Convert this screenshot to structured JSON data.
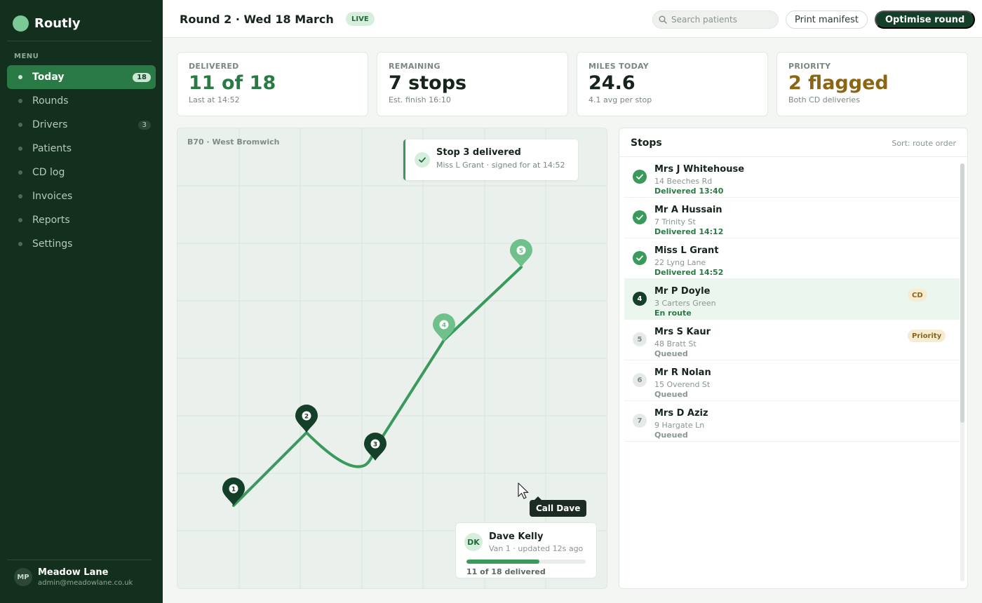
{
  "sidebar": {
    "brand": "Routly",
    "menu_label": "MENU",
    "items": [
      {
        "label": "Today",
        "count": "18"
      },
      {
        "label": "Rounds",
        "count": ""
      },
      {
        "label": "Drivers",
        "count": "3"
      },
      {
        "label": "Patients",
        "count": ""
      },
      {
        "label": "CD log",
        "count": ""
      },
      {
        "label": "Invoices",
        "count": ""
      },
      {
        "label": "Reports",
        "count": ""
      },
      {
        "label": "Settings",
        "count": ""
      }
    ],
    "profile": {
      "initials": "MP",
      "name": "Meadow Lane",
      "email": "admin@meadowlane.co.uk"
    }
  },
  "header": {
    "title": "Round 2 · Wed 18 March",
    "live_badge": "LIVE",
    "search_placeholder": "Search patients",
    "print_label": "Print manifest",
    "optimise_label": "Optimise round"
  },
  "stats": [
    {
      "key": "DELIVERED",
      "value": "11 of 18",
      "sub": "Last at 14:52"
    },
    {
      "key": "REMAINING",
      "value": "7 stops",
      "sub": "Est. finish 16:10"
    },
    {
      "key": "MILES TODAY",
      "value": "24.6",
      "sub": "4.1 avg per stop"
    },
    {
      "key": "PRIORITY",
      "value": "2 flagged",
      "sub": "Both CD deliveries"
    }
  ],
  "map": {
    "area_label": "B70 · West Bromwich",
    "pins": [
      "1",
      "2",
      "3",
      "4",
      "5"
    ],
    "toast": {
      "title": "Stop 3 delivered",
      "subtitle": "Miss L Grant · signed for at 14:52"
    },
    "tooltip": "Call Dave",
    "driver": {
      "initials": "DK",
      "name": "Dave Kelly",
      "meta": "Van 1 · updated 12s ago",
      "progress_fraction": 0.611,
      "progress_text": "11 of 18 delivered"
    }
  },
  "stops": {
    "title": "Stops",
    "sort_label": "Sort: route order",
    "items": [
      {
        "marker": "",
        "name": "Mrs J Whitehouse",
        "address": "14 Beeches Rd",
        "status": "Delivered 13:40",
        "tag": ""
      },
      {
        "marker": "",
        "name": "Mr A Hussain",
        "address": "7 Trinity St",
        "status": "Delivered 14:12",
        "tag": ""
      },
      {
        "marker": "",
        "name": "Miss L Grant",
        "address": "22 Lyng Lane",
        "status": "Delivered 14:52",
        "tag": ""
      },
      {
        "marker": "4",
        "name": "Mr P Doyle",
        "address": "3 Carters Green",
        "status": "En route",
        "tag": "CD"
      },
      {
        "marker": "5",
        "name": "Mrs S Kaur",
        "address": "48 Bratt St",
        "status": "Queued",
        "tag": "Priority"
      },
      {
        "marker": "6",
        "name": "Mr R Nolan",
        "address": "15 Overend St",
        "status": "Queued",
        "tag": ""
      },
      {
        "marker": "7",
        "name": "Mrs D Aziz",
        "address": "9 Hargate Ln",
        "status": "Queued",
        "tag": ""
      }
    ]
  },
  "colors": {
    "sidebar_bg": "#13301f",
    "accent": "#2a7a45",
    "priority": "#8a6514",
    "route_done": "#3a9a5c",
    "route_pending": "#7cc896"
  }
}
